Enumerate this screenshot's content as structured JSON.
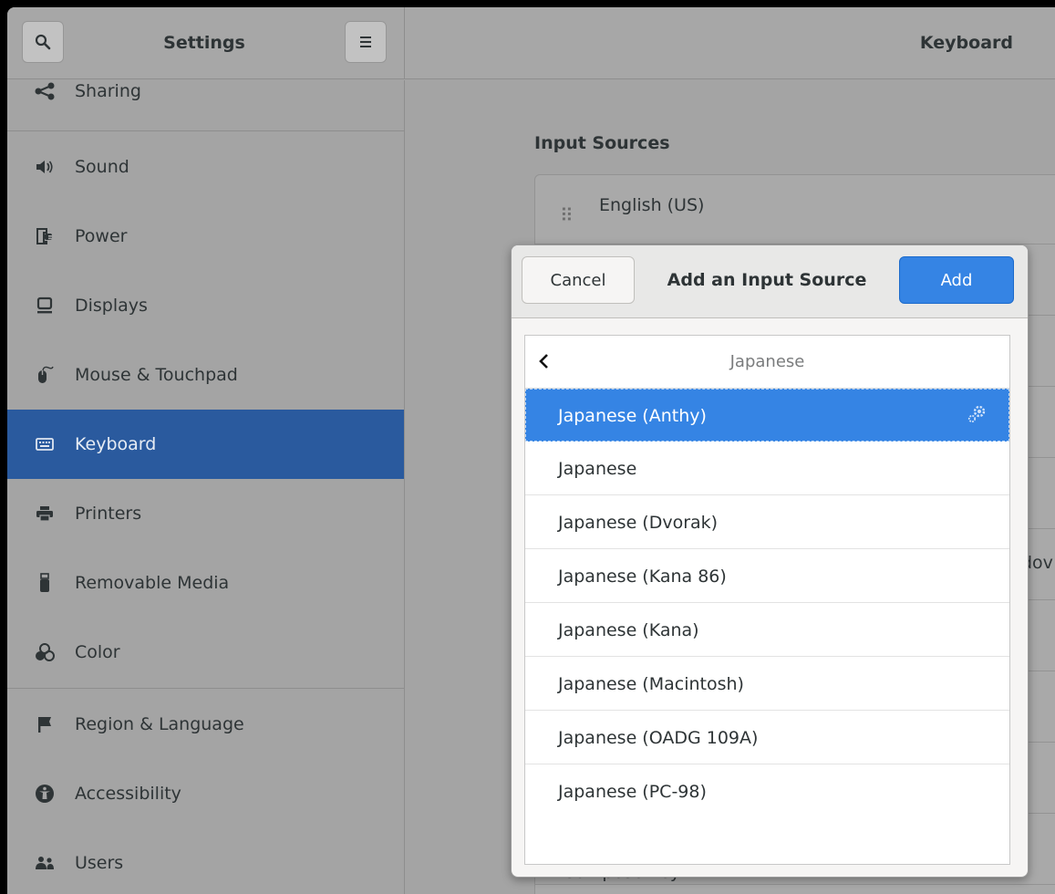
{
  "header": {
    "left_title": "Settings",
    "right_title": "Keyboard",
    "search_icon": "search-icon",
    "menu_icon": "hamburger-menu-icon"
  },
  "sidebar": {
    "items": [
      {
        "label": "Sharing",
        "icon": "share-icon"
      },
      {
        "label": "Sound",
        "icon": "speaker-icon"
      },
      {
        "label": "Power",
        "icon": "power-plug-icon"
      },
      {
        "label": "Displays",
        "icon": "display-icon"
      },
      {
        "label": "Mouse & Touchpad",
        "icon": "mouse-icon"
      },
      {
        "label": "Keyboard",
        "icon": "keyboard-icon",
        "active": true
      },
      {
        "label": "Printers",
        "icon": "printer-icon"
      },
      {
        "label": "Removable Media",
        "icon": "usb-drive-icon"
      },
      {
        "label": "Color",
        "icon": "color-icon"
      },
      {
        "label": "Region & Language",
        "icon": "flag-icon"
      },
      {
        "label": "Accessibility",
        "icon": "accessibility-icon"
      },
      {
        "label": "Users",
        "icon": "users-icon"
      }
    ]
  },
  "main": {
    "section_title": "Input Sources",
    "first_source": "English (US)",
    "partial_text": "dov",
    "compose_key": "Compose Key"
  },
  "dialog": {
    "cancel_label": "Cancel",
    "title": "Add an Input Source",
    "add_label": "Add",
    "list_header": "Japanese",
    "items": [
      "Japanese (Anthy)",
      "Japanese",
      "Japanese (Dvorak)",
      "Japanese (Kana 86)",
      "Japanese (Kana)",
      "Japanese (Macintosh)",
      "Japanese (OADG 109A)",
      "Japanese (PC-98)"
    ],
    "selected_index": 0
  },
  "colors": {
    "accent": "#3584e4",
    "sidebar_active": "#2a5a9e"
  }
}
